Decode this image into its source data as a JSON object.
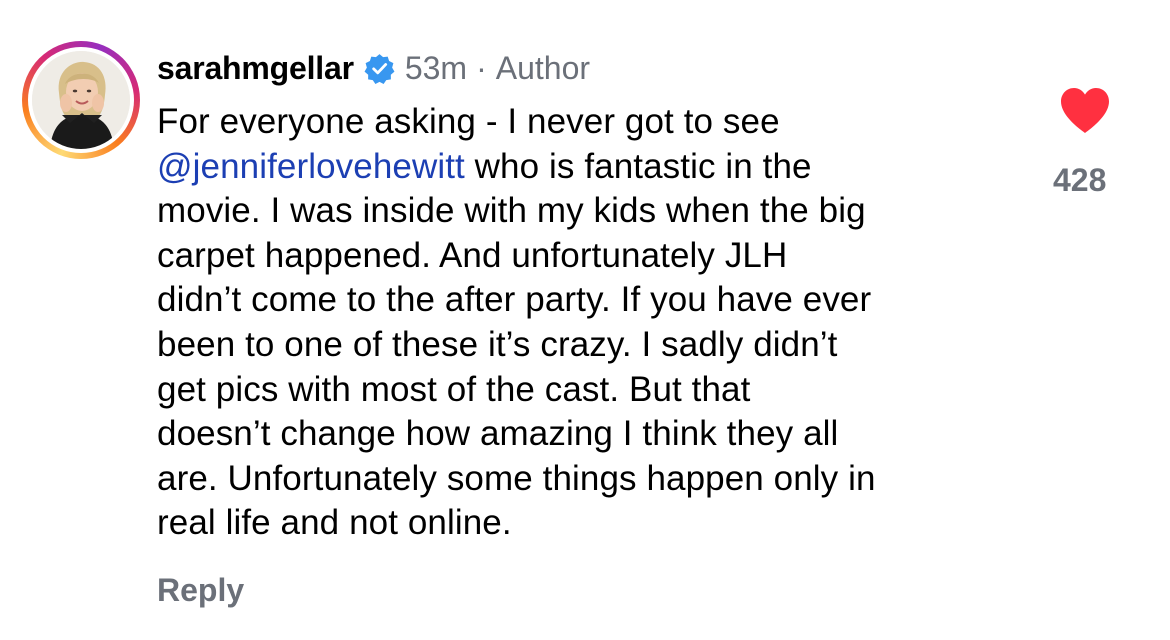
{
  "comment": {
    "author": {
      "username": "sarahmgellar",
      "verified": true,
      "avatar_icon": "profile-photo",
      "story_ring_colors": [
        "#feda75",
        "#fa7e1e",
        "#d62976",
        "#962fbf"
      ]
    },
    "time_ago": "53m",
    "separator": "·",
    "author_label": "Author",
    "text_lines": {
      "line1": "For everyone asking - I never got to see",
      "line2_mention": "@jenniferlovehewitt",
      "line2_rest": " who is fantastic in the",
      "line3": "movie. I was inside with my kids when the big",
      "line4": "carpet happened. And unfortunately JLH",
      "line5": "didn’t come to the after party. If you have ever",
      "line6": "been to one of these it’s crazy. I sadly didn’t",
      "line7": "get pics with most of the cast. But that",
      "line8": "doesn’t change how amazing I think they all",
      "line9": "are. Unfortunately some things happen only in",
      "line10": "real life and not online."
    },
    "reply_label": "Reply",
    "like": {
      "icon": "heart-icon",
      "liked": true,
      "color": "#ff3040",
      "count": "428"
    },
    "colors": {
      "mention": "#1c3fb3",
      "secondary_text": "#6b7079",
      "verified_badge": "#3897f0"
    }
  }
}
